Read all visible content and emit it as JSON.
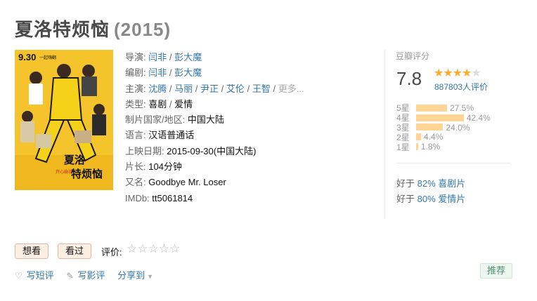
{
  "title": "夏洛特烦恼",
  "year": "(2015)",
  "poster": {
    "date": "9.30",
    "line1": "一起嗨翻",
    "name_top": "夏洛",
    "name_bottom": "特烦恼",
    "slogan": "开心麻花"
  },
  "info": {
    "director_label": "导演:",
    "directors": [
      "闫非",
      "彭大魔"
    ],
    "writer_label": "编剧:",
    "writers": [
      "闫非",
      "彭大魔"
    ],
    "cast_label": "主演:",
    "cast": [
      "沈腾",
      "马丽",
      "尹正",
      "艾伦",
      "王智"
    ],
    "more": "更多...",
    "genre_label": "类型:",
    "genres": [
      "喜剧",
      "爱情"
    ],
    "country_label": "制片国家/地区:",
    "country": "中国大陆",
    "language_label": "语言:",
    "language": "汉语普通话",
    "release_label": "上映日期:",
    "release": "2015-09-30(中国大陆)",
    "runtime_label": "片长:",
    "runtime": "104分钟",
    "aka_label": "又名:",
    "aka": "Goodbye Mr. Loser",
    "imdb_label": "IMDb:",
    "imdb": "tt5061814"
  },
  "rating": {
    "label": "豆瓣评分",
    "score": "7.8",
    "stars_value": 4,
    "people": "887803人评价",
    "distribution": [
      {
        "label": "5星",
        "pct": "27.5%",
        "value": 27.5
      },
      {
        "label": "4星",
        "pct": "42.4%",
        "value": 42.4
      },
      {
        "label": "3星",
        "pct": "24.0%",
        "value": 24.0
      },
      {
        "label": "2星",
        "pct": "4.4%",
        "value": 4.4
      },
      {
        "label": "1星",
        "pct": "1.8%",
        "value": 1.8
      }
    ],
    "better": [
      {
        "prefix": "好于",
        "pct": "82%",
        "genre": "喜剧片"
      },
      {
        "prefix": "好于",
        "pct": "80%",
        "genre": "爱情片"
      }
    ]
  },
  "actions": {
    "want": "想看",
    "seen": "看过",
    "rate_label": "评价:",
    "short_review": "写短评",
    "long_review": "写影评",
    "share": "分享到",
    "recommend": "推荐"
  }
}
